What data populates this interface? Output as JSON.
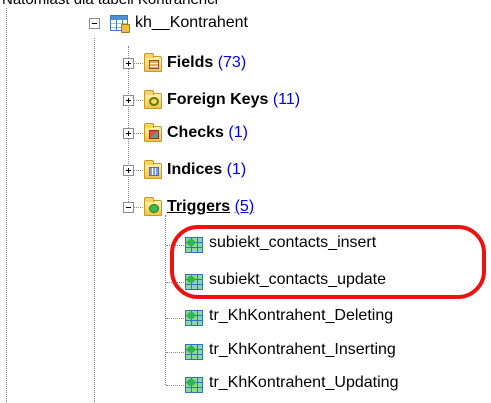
{
  "caption": "Natomiast dla tabeli Kontrahenci",
  "tree": {
    "table": {
      "label": "kh__Kontrahent",
      "icon": "table-icon",
      "expanded": true
    },
    "folders": [
      {
        "label": "Fields",
        "count": "(73)",
        "icon": "fields-folder-icon",
        "expanded": false
      },
      {
        "label": "Foreign Keys",
        "count": "(11)",
        "icon": "foreign-keys-folder-icon",
        "expanded": false
      },
      {
        "label": "Checks",
        "count": "(1)",
        "icon": "checks-folder-icon",
        "expanded": false
      },
      {
        "label": "Indices",
        "count": "(1)",
        "icon": "indices-folder-icon",
        "expanded": false
      },
      {
        "label": "Triggers",
        "count": "(5)",
        "icon": "triggers-folder-icon",
        "expanded": true
      }
    ],
    "triggers": [
      {
        "label": "subiekt_contacts_insert",
        "icon": "trigger-icon"
      },
      {
        "label": "subiekt_contacts_update",
        "icon": "trigger-icon"
      },
      {
        "label": "tr_KhKontrahent_Deleting",
        "icon": "trigger-icon"
      },
      {
        "label": "tr_KhKontrahent_Inserting",
        "icon": "trigger-icon"
      },
      {
        "label": "tr_KhKontrahent_Updating",
        "icon": "trigger-icon"
      }
    ]
  },
  "annotation": {
    "type": "red-ellipse",
    "color": "#ee1111"
  }
}
